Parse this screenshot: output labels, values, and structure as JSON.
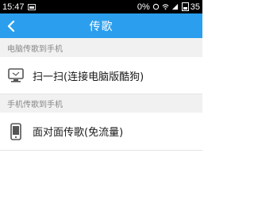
{
  "status_bar": {
    "time": "15:47",
    "signal_text": "0%",
    "battery_level": "35"
  },
  "nav": {
    "title": "传歌"
  },
  "sections": [
    {
      "header": "电脑传歌到手机",
      "item_label": "扫一扫(连接电脑版酷狗)",
      "icon": "monitor-icon"
    },
    {
      "header": "手机传歌到手机",
      "item_label": "面对面传歌(免流量)",
      "icon": "phone-icon"
    }
  ],
  "colors": {
    "nav_bg": "#2b9fee",
    "section_bg": "#f1f1f1",
    "icon_gray": "#555555"
  }
}
